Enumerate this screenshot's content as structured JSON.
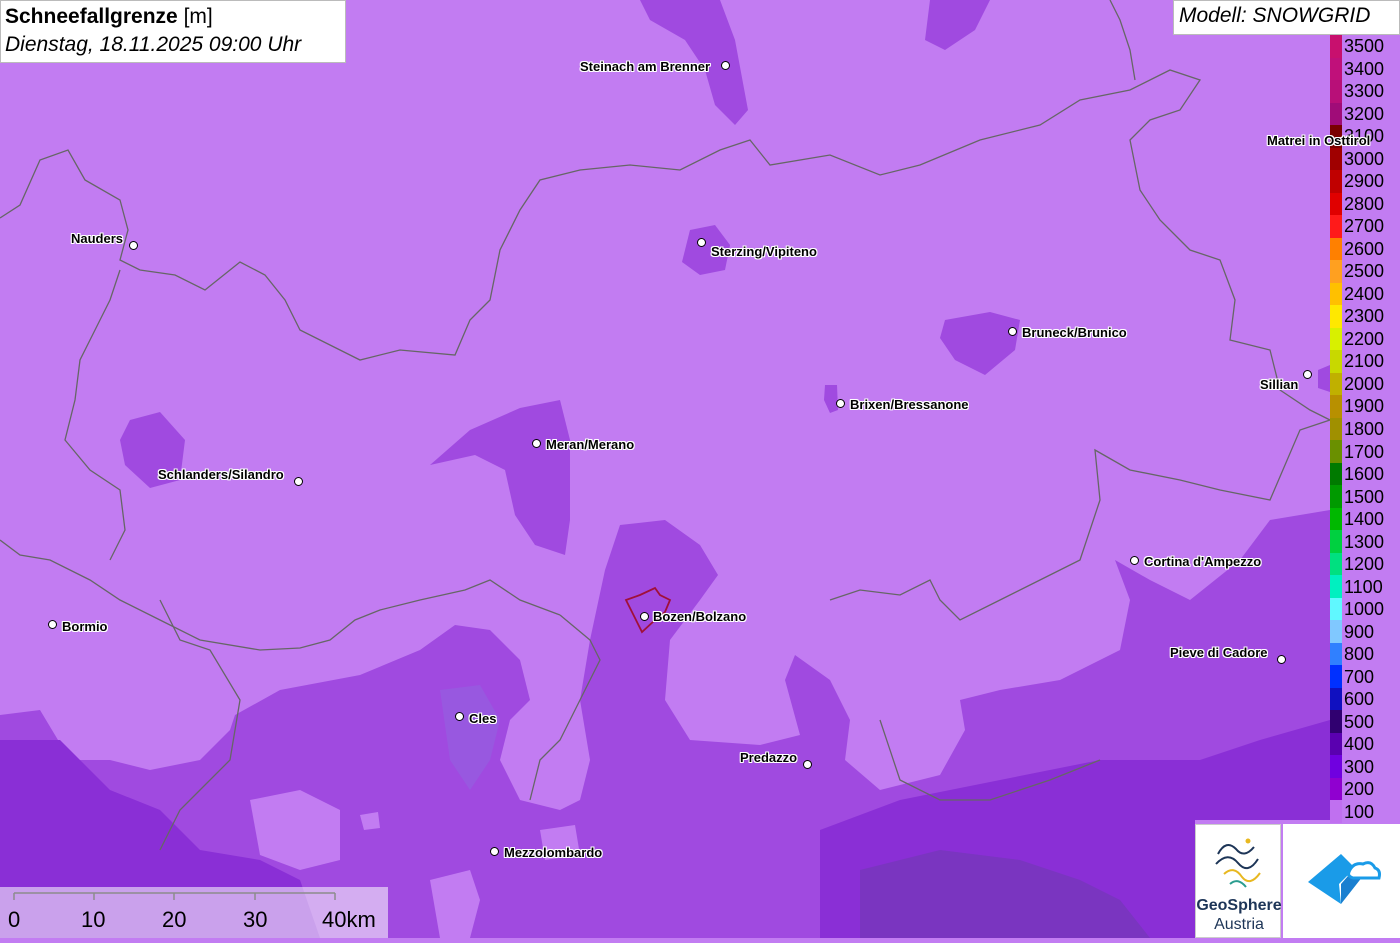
{
  "header": {
    "title_bold": "Schneefallgrenze",
    "title_unit": "[m]",
    "subtitle": "Dienstag, 18.11.2025 09:00 Uhr"
  },
  "model": {
    "label": "Modell: SNOWGRID"
  },
  "legend": {
    "entries": [
      {
        "label": "3500",
        "color": "#c8106e"
      },
      {
        "label": "3400",
        "color": "#c0107a"
      },
      {
        "label": "3300",
        "color": "#b80f78"
      },
      {
        "label": "3200",
        "color": "#a00c78"
      },
      {
        "label": "3100",
        "color": "#7a0000"
      },
      {
        "label": "3000",
        "color": "#a00000"
      },
      {
        "label": "2900",
        "color": "#c00000"
      },
      {
        "label": "2800",
        "color": "#e00000"
      },
      {
        "label": "2700",
        "color": "#ff1a1a"
      },
      {
        "label": "2600",
        "color": "#ff8000"
      },
      {
        "label": "2500",
        "color": "#ffa020"
      },
      {
        "label": "2400",
        "color": "#ffc000"
      },
      {
        "label": "2300",
        "color": "#ffe800"
      },
      {
        "label": "2200",
        "color": "#d8f000"
      },
      {
        "label": "2100",
        "color": "#c8d800"
      },
      {
        "label": "2000",
        "color": "#c0b000"
      },
      {
        "label": "1900",
        "color": "#b89000"
      },
      {
        "label": "1800",
        "color": "#a09000"
      },
      {
        "label": "1700",
        "color": "#6a9000"
      },
      {
        "label": "1600",
        "color": "#007a00"
      },
      {
        "label": "1500",
        "color": "#009a00"
      },
      {
        "label": "1400",
        "color": "#00b800"
      },
      {
        "label": "1300",
        "color": "#00d040"
      },
      {
        "label": "1200",
        "color": "#00e080"
      },
      {
        "label": "1100",
        "color": "#00f0c0"
      },
      {
        "label": "1000",
        "color": "#60f8ff"
      },
      {
        "label": "900",
        "color": "#80c8ff"
      },
      {
        "label": "800",
        "color": "#3080ff"
      },
      {
        "label": "700",
        "color": "#0030ff"
      },
      {
        "label": "600",
        "color": "#1010c0"
      },
      {
        "label": "500",
        "color": "#300070"
      },
      {
        "label": "400",
        "color": "#5a00b0"
      },
      {
        "label": "300",
        "color": "#7000e0"
      },
      {
        "label": "200",
        "color": "#9000d0"
      },
      {
        "label": "100",
        "color": "#c070f0"
      }
    ]
  },
  "cities": [
    {
      "name": "Steinach am Brenner"
    },
    {
      "name": "Nauders"
    },
    {
      "name": "Sterzing/Vipiteno"
    },
    {
      "name": "Matrei in Osttirol"
    },
    {
      "name": "Bruneck/Brunico"
    },
    {
      "name": "Sillian"
    },
    {
      "name": "Brixen/Bressanone"
    },
    {
      "name": "Meran/Merano"
    },
    {
      "name": "Schlanders/Silandro"
    },
    {
      "name": "Cortina d'Ampezzo"
    },
    {
      "name": "Bozen/Bolzano"
    },
    {
      "name": "Bormio"
    },
    {
      "name": "Pieve di Cadore"
    },
    {
      "name": "Cles"
    },
    {
      "name": "Predazzo"
    },
    {
      "name": "Mezzolombardo"
    }
  ],
  "scale": {
    "ticks": [
      "0",
      "10",
      "20",
      "30",
      "40km"
    ]
  },
  "logo": {
    "line1": "GeoSphere",
    "line2": "Austria"
  },
  "colors": {
    "base_fill": "#c27cf2",
    "mid_fill": "#a04ae0",
    "dark_fill": "#8a2fd6",
    "deep_fill": "#7a35c0",
    "border_line": "#666666",
    "bolzano_outline": "#a0103a"
  }
}
